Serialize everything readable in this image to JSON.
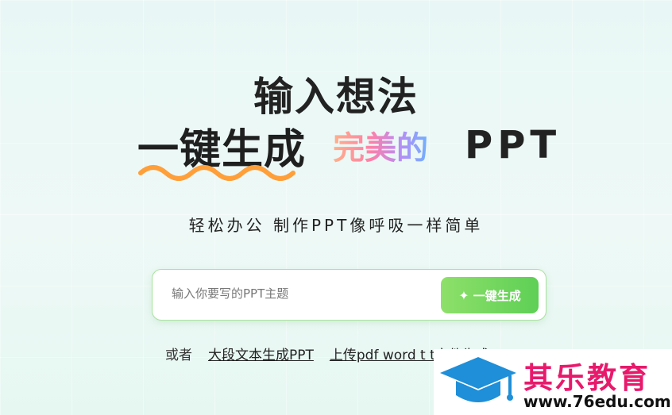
{
  "hero": {
    "line1": "输入想法",
    "line2_main": "一键生成",
    "line2_gradient": "完美的",
    "line2_end": "PPT"
  },
  "slogan": "轻松办公 制作PPT像呼吸一样简单",
  "search": {
    "placeholder": "输入你要写的PPT主题",
    "button_label": "一键生成",
    "button_icon": "sparkle-icon"
  },
  "options": {
    "prefix": "或者",
    "link1": "大段文本生成PPT",
    "link2": "上传pdf word t t文件生成PPT"
  },
  "watermark": {
    "title": "其乐教育",
    "url": "www.76edu.com"
  },
  "colors": {
    "accent_green": "#5ecf55",
    "wave_orange": "#ff9f3a",
    "watermark_pink": "#e8196b",
    "watermark_blue": "#1e8fd8"
  }
}
